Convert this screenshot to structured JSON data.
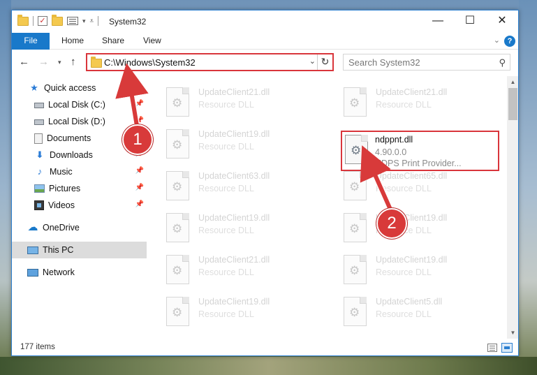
{
  "window": {
    "title": "System32",
    "controls": {
      "minimize": "—",
      "maximize": "☐",
      "close": "✕"
    }
  },
  "ribbon": {
    "tabs": [
      "File",
      "Home",
      "Share",
      "View"
    ],
    "help": "?"
  },
  "address_bar": {
    "path": "C:\\Windows\\System32",
    "search_placeholder": "Search System32"
  },
  "navigation_pane": {
    "items": [
      {
        "label": "Quick access",
        "icon": "star-icon"
      },
      {
        "label": "Local Disk (C:)",
        "icon": "drive-icon",
        "pinned": true
      },
      {
        "label": "Local Disk (D:)",
        "icon": "drive-icon",
        "pinned": true
      },
      {
        "label": "Documents",
        "icon": "documents-icon",
        "pinned": true
      },
      {
        "label": "Downloads",
        "icon": "download-icon",
        "pinned": true
      },
      {
        "label": "Music",
        "icon": "music-icon",
        "pinned": true
      },
      {
        "label": "Pictures",
        "icon": "pictures-icon",
        "pinned": true
      },
      {
        "label": "Videos",
        "icon": "videos-icon",
        "pinned": true
      },
      {
        "label": "OneDrive",
        "icon": "cloud-icon"
      },
      {
        "label": "This PC",
        "icon": "computer-icon",
        "selected": true
      },
      {
        "label": "Network",
        "icon": "network-icon"
      }
    ]
  },
  "files": {
    "left_column": [
      {
        "name": "UpdateClient21.dll",
        "type": "Resource DLL"
      },
      {
        "name": "UpdateClient19.dll",
        "type": "Resource DLL"
      },
      {
        "name": "UpdateClient63.dll",
        "type": "Resource DLL"
      },
      {
        "name": "UpdateClient19.dll",
        "type": "Resource DLL"
      },
      {
        "name": "UpdateClient21.dll",
        "type": "Resource DLL"
      },
      {
        "name": "UpdateClient19.dll",
        "type": "Resource DLL"
      }
    ],
    "right_column": [
      {
        "name": "UpdateClient21.dll",
        "type": "Resource DLL"
      },
      {
        "name": "ndppnt.dll",
        "version": "4.90.0.0",
        "description": "NDPS Print Provider...",
        "highlighted": true
      },
      {
        "name": "UpdateClient65.dll",
        "type": "Resource DLL"
      },
      {
        "name": "UpdateClient19.dll",
        "type": "Resource DLL"
      },
      {
        "name": "UpdateClient19.dll",
        "type": "Resource DLL"
      },
      {
        "name": "UpdateClient5.dll",
        "type": "Resource DLL"
      }
    ]
  },
  "status_bar": {
    "item_count": "177 items"
  },
  "annotations": {
    "step1": "1",
    "step2": "2",
    "color": "#d83a3a"
  },
  "colors": {
    "accent": "#1979ca",
    "highlight_border": "#d9353b"
  }
}
